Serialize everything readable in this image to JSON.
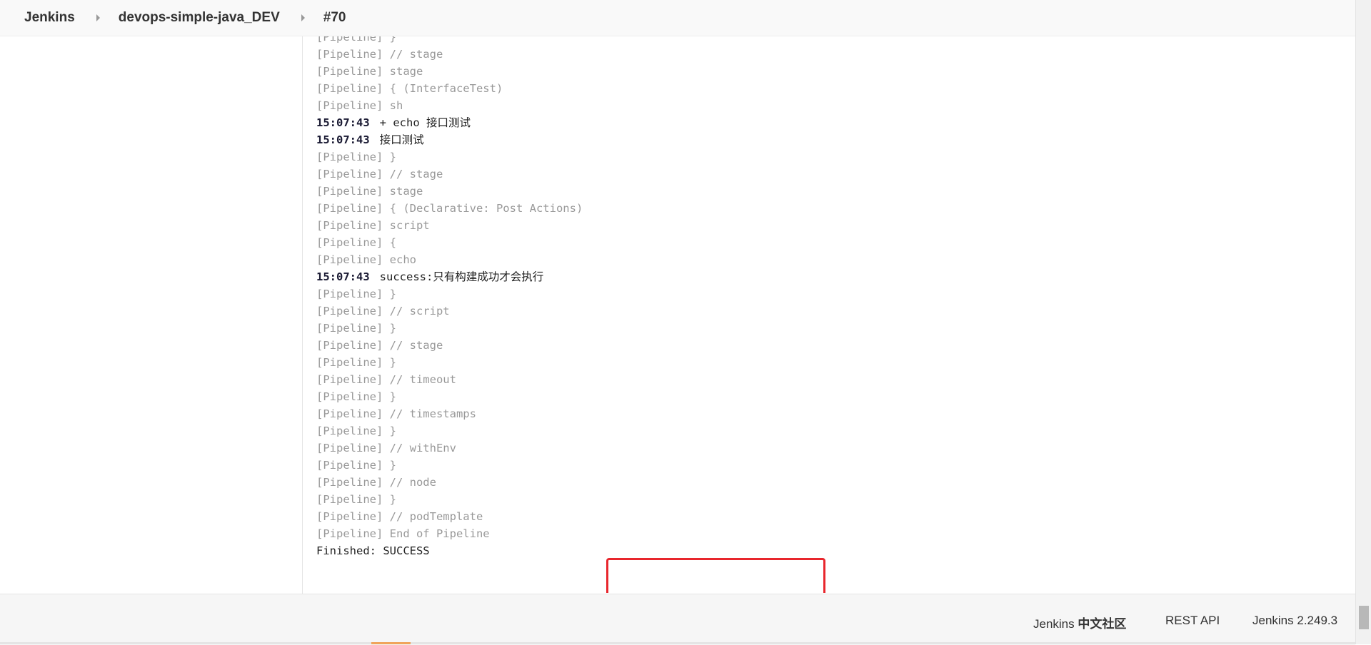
{
  "breadcrumb": [
    {
      "label": "Jenkins"
    },
    {
      "label": "devops-simple-java_DEV"
    },
    {
      "label": "#70"
    }
  ],
  "console": {
    "lines": [
      {
        "kind": "pipeline",
        "text": "[Pipeline] }"
      },
      {
        "kind": "pipeline",
        "text": "[Pipeline] // stage"
      },
      {
        "kind": "pipeline",
        "text": "[Pipeline] stage"
      },
      {
        "kind": "pipeline",
        "text": "[Pipeline] { (InterfaceTest)"
      },
      {
        "kind": "pipeline",
        "text": "[Pipeline] sh"
      },
      {
        "kind": "output",
        "ts": "15:07:43",
        "text": "+ echo 接口测试"
      },
      {
        "kind": "output",
        "ts": "15:07:43",
        "text": "接口测试"
      },
      {
        "kind": "pipeline",
        "text": "[Pipeline] }"
      },
      {
        "kind": "pipeline",
        "text": "[Pipeline] // stage"
      },
      {
        "kind": "pipeline",
        "text": "[Pipeline] stage"
      },
      {
        "kind": "pipeline",
        "text": "[Pipeline] { (Declarative: Post Actions)"
      },
      {
        "kind": "pipeline",
        "text": "[Pipeline] script"
      },
      {
        "kind": "pipeline",
        "text": "[Pipeline] {"
      },
      {
        "kind": "pipeline",
        "text": "[Pipeline] echo"
      },
      {
        "kind": "output",
        "ts": "15:07:43",
        "text": "success:只有构建成功才会执行"
      },
      {
        "kind": "pipeline",
        "text": "[Pipeline] }"
      },
      {
        "kind": "pipeline",
        "text": "[Pipeline] // script"
      },
      {
        "kind": "pipeline",
        "text": "[Pipeline] }"
      },
      {
        "kind": "pipeline",
        "text": "[Pipeline] // stage"
      },
      {
        "kind": "pipeline",
        "text": "[Pipeline] }"
      },
      {
        "kind": "pipeline",
        "text": "[Pipeline] // timeout"
      },
      {
        "kind": "pipeline",
        "text": "[Pipeline] }"
      },
      {
        "kind": "pipeline",
        "text": "[Pipeline] // timestamps"
      },
      {
        "kind": "pipeline",
        "text": "[Pipeline] }"
      },
      {
        "kind": "pipeline",
        "text": "[Pipeline] // withEnv"
      },
      {
        "kind": "pipeline",
        "text": "[Pipeline] }"
      },
      {
        "kind": "pipeline",
        "text": "[Pipeline] // node"
      },
      {
        "kind": "pipeline",
        "text": "[Pipeline] }"
      },
      {
        "kind": "pipeline",
        "text": "[Pipeline] // podTemplate"
      },
      {
        "kind": "pipeline",
        "text": "[Pipeline] End of Pipeline"
      },
      {
        "kind": "plain",
        "text": "Finished: SUCCESS"
      }
    ]
  },
  "footer": {
    "community_prefix": "Jenkins ",
    "community_suffix": "中文社区",
    "rest_api": "REST API",
    "version": "Jenkins 2.249.3"
  },
  "colors": {
    "highlight": "#e8262d",
    "timestamp": "#1a1a33",
    "pipeline_text": "#999999"
  }
}
